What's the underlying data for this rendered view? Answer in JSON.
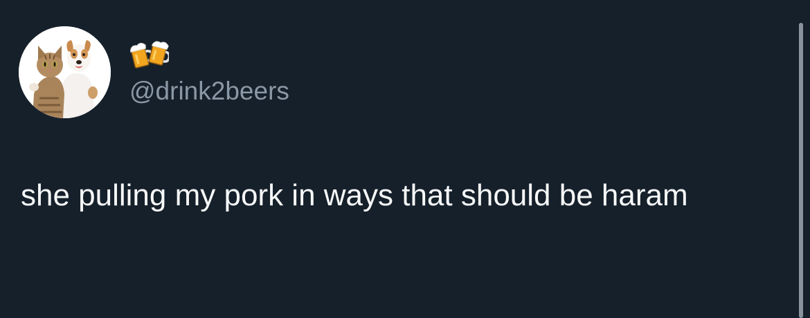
{
  "tweet": {
    "author": {
      "display_name_emoji": "🍻",
      "handle": "@drink2beers",
      "avatar_icon": "cat-and-dog-avatar"
    },
    "text": "she pulling my pork in ways that should be haram"
  },
  "colors": {
    "background": "#16202b",
    "text": "#f7f9f9",
    "handle": "#8b98a5",
    "scrollbar": "#8a939c"
  }
}
